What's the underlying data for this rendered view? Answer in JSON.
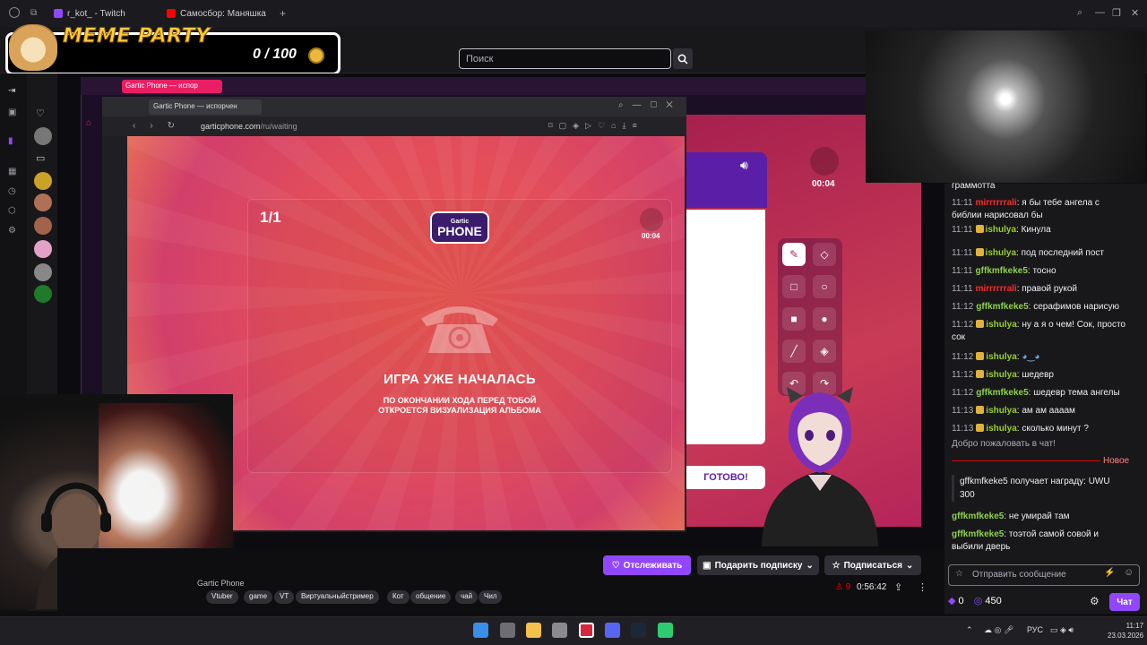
{
  "browser_tabs": [
    {
      "label": "r_kot_ - Twitch"
    },
    {
      "label": "Самосбор: Маняшка"
    }
  ],
  "twitch": {
    "search_placeholder": "Поиск",
    "follow_label": "Отслеживать",
    "gift_label": "Подарить подписку",
    "subscribe_label": "Подписаться",
    "viewers": "9",
    "uptime": "0:56:42",
    "game_title": "Gartic Phone",
    "tags": [
      "Vtuber",
      "game",
      "VT",
      "Виртуальныйстример",
      "Кот",
      "общение",
      "чай",
      "Чил"
    ]
  },
  "overlay": {
    "title": "MEME PARTY",
    "counter": "0 / 100"
  },
  "inner_browser": {
    "bg_tab": "Gartic Phone — испор",
    "fg_tab": "Gartic Phone — испорчен",
    "url_host": "garticphone.com",
    "url_path": "/ru/waiting"
  },
  "game": {
    "round": "1/1",
    "logo_small": "Gartic",
    "logo_big": "PHONE",
    "timer": "00:04",
    "heading": "ИГРА УЖЕ НАЧАЛАСЬ",
    "subtext_1": "ПО ОКОНЧАНИИ ХОДА ПЕРЕД ТОБОЙ",
    "subtext_2": "ОТКРОЕТСЯ ВИЗУАЛИЗАЦИЯ АЛЬБОМА",
    "right_timer": "00:04",
    "done_label": "ГОТОВО!"
  },
  "chat": {
    "top_fragment": "граммотта",
    "messages": [
      {
        "time": "11:11",
        "user": "mirrrrrrali",
        "color": "red",
        "text": "я бы тебе ангела с библии нарисовал бы"
      },
      {
        "time": "11:11",
        "user": "ishulya",
        "color": "yel",
        "text": "Кинула"
      },
      {
        "time": "11:11",
        "user": "ishulya",
        "color": "yel",
        "text": "под последний пост"
      },
      {
        "time": "11:11",
        "user": "gffkmfkeke5",
        "color": "green",
        "text": "тосно"
      },
      {
        "time": "11:11",
        "user": "mirrrrrrali",
        "color": "red",
        "text": "правой рукой"
      },
      {
        "time": "11:12",
        "user": "gffkmfkeke5",
        "color": "green",
        "text": "серафимов нарисую"
      },
      {
        "time": "11:12",
        "user": "ishulya",
        "color": "yel",
        "text": "ну а я о чем! Сок, просто сок"
      },
      {
        "time": "11:12",
        "user": "ishulya",
        "color": "yel",
        "text": ""
      },
      {
        "time": "11:12",
        "user": "ishulya",
        "color": "yel",
        "text": "шедевр"
      },
      {
        "time": "11:12",
        "user": "gffkmfkeke5",
        "color": "green",
        "text": "шедевр тема ангелы"
      },
      {
        "time": "11:13",
        "user": "ishulya",
        "color": "yel",
        "text": "ам ам аааам"
      },
      {
        "time": "11:13",
        "user": "ishulya",
        "color": "yel",
        "text": "сколько минут ?"
      }
    ],
    "welcome": "Добро пожаловать в чат!",
    "new_label": "Новое",
    "reward": "gffkmfkeke5 получает награду: UWU 300",
    "after": [
      {
        "user": "gffkmfkeke5",
        "text": "не умирай там"
      },
      {
        "user": "gffkmfkeke5",
        "text": "тоэтой самой совой и выбили дверь"
      }
    ],
    "input_placeholder": "Отправить сообщение",
    "points_a": "0",
    "points_b": "450",
    "chat_button": "Чат"
  },
  "taskbar": {
    "lang": "РУС",
    "time": "11:17",
    "date": "23.03.2026"
  },
  "colors": {
    "twitch_purple": "#9147ff",
    "game_red": "#e24d5b",
    "live_red": "#eb0400"
  }
}
